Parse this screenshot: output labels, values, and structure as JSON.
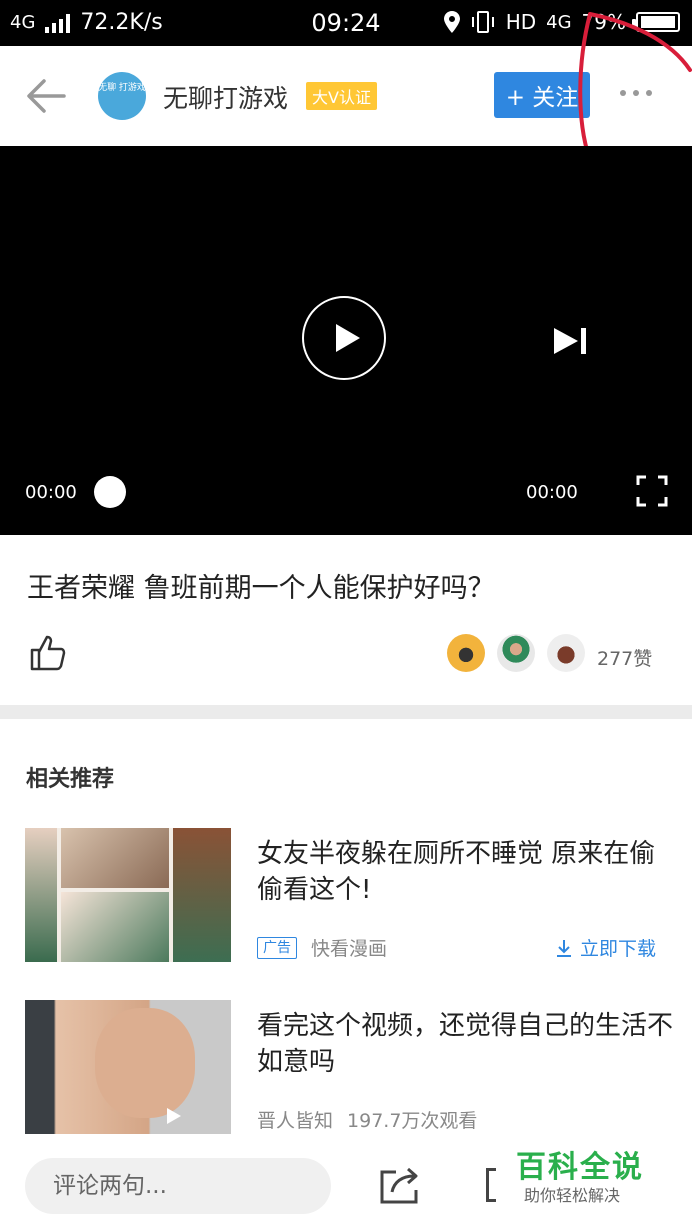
{
  "status_bar": {
    "network": "4G",
    "speed": "72.2K/s",
    "time": "09:24",
    "hd": "HD",
    "network2": "4G",
    "battery": "79%"
  },
  "header": {
    "username": "无聊打游戏",
    "badge": "大V认证",
    "follow_label": "+ 关注",
    "avatar_text": "无聊 打游戏"
  },
  "player": {
    "current_time": "00:00",
    "duration": "00:00"
  },
  "video": {
    "title": "王者荣耀 鲁班前期一个人能保护好吗？",
    "likes": "277赞"
  },
  "related": {
    "heading": "相关推荐",
    "items": [
      {
        "title": "女友半夜躲在厕所不睡觉 原来在偷偷看这个!",
        "ad_label": "广告",
        "source": "快看漫画",
        "action": "立即下载"
      },
      {
        "title": "看完这个视频，还觉得自己的生活不如意吗",
        "source": "晋人皆知",
        "views": "197.7万次观看"
      }
    ]
  },
  "bottom": {
    "comment_placeholder": "评论两句..."
  },
  "watermark": {
    "brand": "百科全说",
    "sub": "助你轻松解决"
  },
  "colors": {
    "accent": "#2f87e0",
    "badge": "#ffc735",
    "annotation": "#d81e3a",
    "watermark": "#2aaf4c"
  }
}
